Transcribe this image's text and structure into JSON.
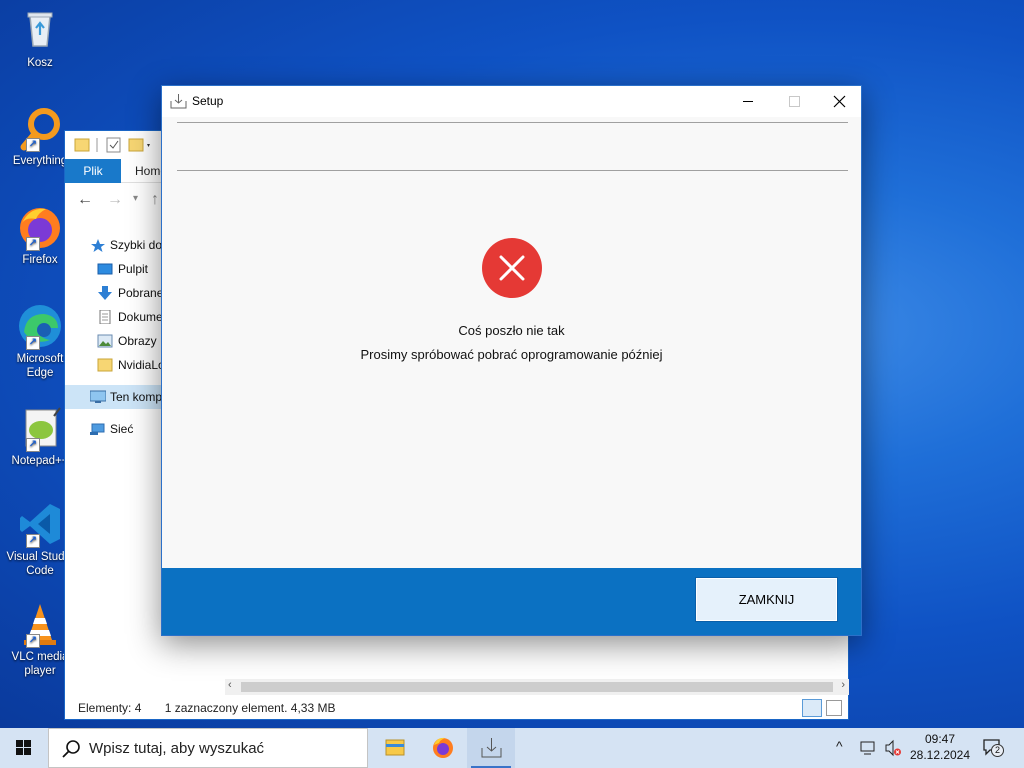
{
  "desktop": {
    "icons": [
      {
        "label": "Kosz"
      },
      {
        "label": "Everything"
      },
      {
        "label": "Firefox"
      },
      {
        "label": "Microsoft Edge"
      },
      {
        "label": "Notepad++"
      },
      {
        "label": "Visual Studio Code"
      },
      {
        "label": "VLC media player"
      }
    ]
  },
  "explorer": {
    "ribbon": {
      "tab_file": "Plik",
      "tab_home": "Home"
    },
    "tree": [
      {
        "label": "Szybki dostęp"
      },
      {
        "label": "Pulpit"
      },
      {
        "label": "Pobrane"
      },
      {
        "label": "Dokumenty"
      },
      {
        "label": "Obrazy"
      },
      {
        "label": "NvidiaLogs"
      },
      {
        "label": "Ten komputer"
      },
      {
        "label": "Sieć"
      }
    ],
    "status": {
      "count": "Elementy: 4",
      "selection": "1 zaznaczony element. 4,33 MB"
    }
  },
  "setup": {
    "title": "Setup",
    "message_title": "Coś poszło nie tak",
    "message_body": "Prosimy spróbować pobrać oprogramowanie później",
    "close_button": "ZAMKNIJ",
    "colors": {
      "footer": "#0b71c2",
      "error": "#e53935"
    }
  },
  "taskbar": {
    "search_placeholder": "Wpisz tutaj, aby wyszukać",
    "time": "09:47",
    "date": "28.12.2024",
    "notification_count": "2"
  }
}
